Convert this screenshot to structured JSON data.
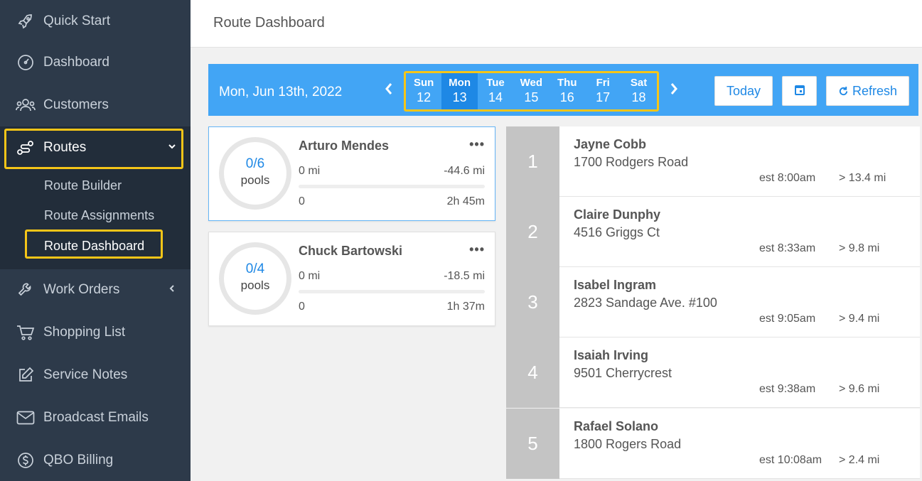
{
  "sidebar": {
    "items": [
      {
        "label": "Quick Start",
        "icon": "rocket-icon"
      },
      {
        "label": "Dashboard",
        "icon": "gauge-icon"
      },
      {
        "label": "Customers",
        "icon": "users-icon"
      },
      {
        "label": "Routes",
        "icon": "route-icon"
      },
      {
        "label": "Work Orders",
        "icon": "wrench-icon"
      },
      {
        "label": "Shopping List",
        "icon": "cart-icon"
      },
      {
        "label": "Service Notes",
        "icon": "edit-icon"
      },
      {
        "label": "Broadcast Emails",
        "icon": "envelope-icon"
      },
      {
        "label": "QBO Billing",
        "icon": "dollar-icon"
      }
    ],
    "routes_sub": [
      "Route Builder",
      "Route Assignments",
      "Route Dashboard"
    ]
  },
  "header": {
    "title": "Route Dashboard"
  },
  "datebar": {
    "current_date": "Mon, Jun 13th, 2022",
    "days": [
      {
        "name": "Sun",
        "date": "12"
      },
      {
        "name": "Mon",
        "date": "13"
      },
      {
        "name": "Tue",
        "date": "14"
      },
      {
        "name": "Wed",
        "date": "15"
      },
      {
        "name": "Thu",
        "date": "16"
      },
      {
        "name": "Fri",
        "date": "17"
      },
      {
        "name": "Sat",
        "date": "18"
      }
    ],
    "today_label": "Today",
    "refresh_label": "Refresh"
  },
  "routes": [
    {
      "tech": "Arturo Mendes",
      "pools": "0/6",
      "unit": "pools",
      "mi_done": "0 mi",
      "mi_diff": "-44.6 mi",
      "count": "0",
      "duration": "2h 45m"
    },
    {
      "tech": "Chuck Bartowski",
      "pools": "0/4",
      "unit": "pools",
      "mi_done": "0 mi",
      "mi_diff": "-18.5 mi",
      "count": "0",
      "duration": "1h 37m"
    }
  ],
  "stops": [
    {
      "num": "1",
      "name": "Jayne Cobb",
      "address": "1700 Rodgers Road",
      "est": "est 8:00am",
      "dist": "> 13.4 mi"
    },
    {
      "num": "2",
      "name": "Claire Dunphy",
      "address": "4516 Griggs Ct",
      "est": "est 8:33am",
      "dist": "> 9.8 mi"
    },
    {
      "num": "3",
      "name": "Isabel Ingram",
      "address": "2823 Sandage Ave. #100",
      "est": "est 9:05am",
      "dist": "> 9.4 mi"
    },
    {
      "num": "4",
      "name": "Isaiah Irving",
      "address": "9501 Cherrycrest",
      "est": "est 9:38am",
      "dist": "> 9.6 mi"
    },
    {
      "num": "5",
      "name": "Rafael Solano",
      "address": "1800 Rogers Road",
      "est": "est 10:08am",
      "dist": "> 2.4 mi"
    }
  ],
  "colors": {
    "sidebar": "#2d3a4a",
    "accent": "#42a5f5",
    "active_day": "#1e88e5",
    "highlight": "#f5c518"
  }
}
